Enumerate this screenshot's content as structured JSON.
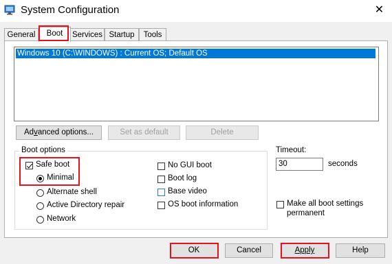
{
  "window": {
    "title": "System Configuration",
    "close_glyph": "✕",
    "icon": "system-config-icon"
  },
  "tabs": [
    {
      "label": "General"
    },
    {
      "label": "Boot",
      "selected": true
    },
    {
      "label": "Services"
    },
    {
      "label": "Startup"
    },
    {
      "label": "Tools"
    }
  ],
  "os_list": {
    "items": [
      "Windows 10 (C:\\WINDOWS) : Current OS; Default OS"
    ],
    "selected_index": 0
  },
  "buttons": {
    "advanced_pre": "Ad",
    "advanced_key": "v",
    "advanced_post": "anced options...",
    "set_default": "Set as default",
    "delete": "Delete"
  },
  "boot_options": {
    "legend": "Boot options",
    "safe_boot": {
      "label": "Safe boot",
      "checked": true
    },
    "minimal": {
      "label": "Minimal",
      "checked": true
    },
    "alternate_shell": {
      "label": "Alternate shell",
      "checked": false
    },
    "ad_repair": {
      "label": "Active Directory repair",
      "checked": false
    },
    "network": {
      "label": "Network",
      "checked": false
    },
    "no_gui_boot": {
      "label": "No GUI boot",
      "checked": false
    },
    "boot_log": {
      "label": "Boot log",
      "checked": false
    },
    "base_video": {
      "label": "Base video",
      "checked": false
    },
    "os_boot_info": {
      "label": "OS boot information",
      "checked": false
    }
  },
  "timeout": {
    "label": "Timeout:",
    "value": "30",
    "unit": "seconds"
  },
  "make_permanent": {
    "line1": "Make all boot settings",
    "line2": "permanent",
    "checked": false
  },
  "footer": {
    "ok": "OK",
    "cancel": "Cancel",
    "apply": "Apply",
    "help": "Help"
  },
  "colors": {
    "highlight": "#e8101d",
    "selection": "#0078d7",
    "focus_blue": "#2c7ad6"
  }
}
